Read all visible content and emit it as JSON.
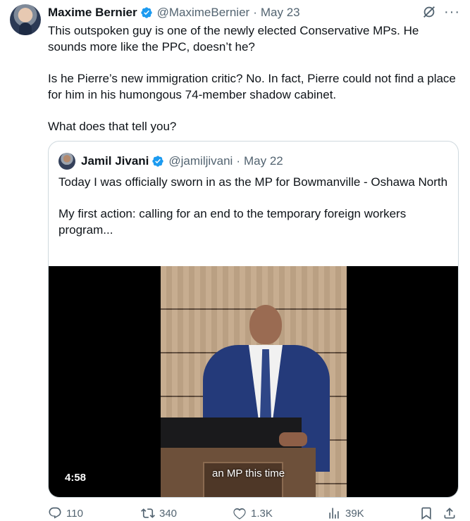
{
  "author": {
    "name": "Maxime Bernier",
    "handle": "@MaximeBernier",
    "separator": "·",
    "date": "May 23"
  },
  "tweet": {
    "paragraphs": [
      "This outspoken guy is one of the newly elected Conservative MPs. He sounds more like the PPC, doesn’t he?",
      "Is he Pierre’s new immigration critic? No. In fact, Pierre could not find a place for him in his humongous 74-member shadow cabinet.",
      "What does that tell you?"
    ]
  },
  "quoted": {
    "name": "Jamil Jivani",
    "handle": "@jamiljivani",
    "separator": "·",
    "date": "May 22",
    "paragraphs": [
      "Today I was officially sworn in as the MP for Bowmanville - Oshawa North",
      "My first action: calling for an end to the temporary foreign workers program..."
    ],
    "video": {
      "caption": "an MP this time",
      "duration": "4:58"
    }
  },
  "stats": {
    "replies": "110",
    "reposts": "340",
    "likes": "1.3K",
    "views": "39K"
  },
  "icons": {
    "verified": "verified-badge-icon",
    "grok": "grok-icon",
    "more": "more-icon",
    "reply": "reply-icon",
    "repost": "repost-icon",
    "like": "like-icon",
    "views": "views-icon",
    "bookmark": "bookmark-icon",
    "share": "share-icon"
  },
  "colors": {
    "text": "#0f1419",
    "secondary": "#536471",
    "verified_blue": "#1d9bf0",
    "border": "#cfd9de"
  }
}
